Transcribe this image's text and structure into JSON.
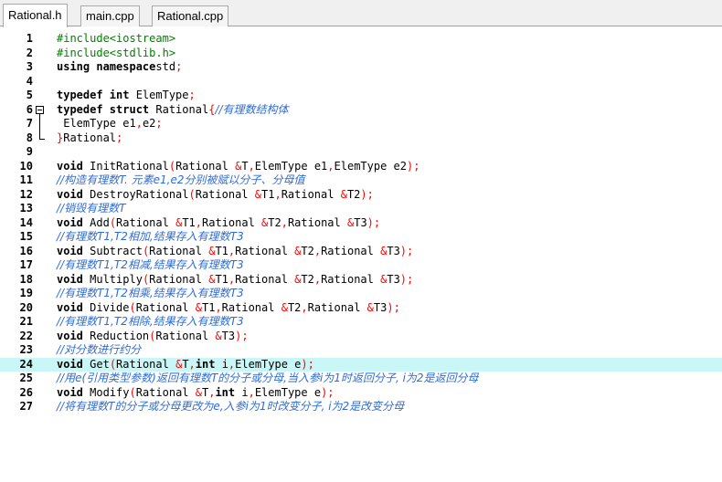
{
  "tabs": [
    {
      "label": "Rational.h",
      "active": true
    },
    {
      "label": "main.cpp",
      "active": false
    },
    {
      "label": "Rational.cpp",
      "active": false
    }
  ],
  "editor": {
    "highlight_line": 24,
    "lines": [
      {
        "n": "1",
        "t": [
          [
            "pp",
            "#include<iostream>"
          ]
        ]
      },
      {
        "n": "2",
        "t": [
          [
            "pp",
            "#include<stdlib.h>"
          ]
        ]
      },
      {
        "n": "3",
        "t": [
          [
            "kw",
            "using namespace"
          ],
          [
            "",
            "std"
          ],
          [
            "sym",
            ";"
          ]
        ]
      },
      {
        "n": "4",
        "t": []
      },
      {
        "n": "5",
        "t": [
          [
            "kw",
            "typedef int"
          ],
          [
            "",
            " ElemType"
          ],
          [
            "sym",
            ";"
          ]
        ]
      },
      {
        "n": "6",
        "t": [
          [
            "kw",
            "typedef struct"
          ],
          [
            "",
            " Rational"
          ],
          [
            "sym",
            "{"
          ],
          [
            "cm",
            "//有理数结构体"
          ]
        ]
      },
      {
        "n": "7",
        "t": [
          [
            "",
            " ElemType e1"
          ],
          [
            "sym",
            ","
          ],
          [
            "",
            "e2"
          ],
          [
            "sym",
            ";"
          ]
        ]
      },
      {
        "n": "8",
        "t": [
          [
            "sym",
            "}"
          ],
          [
            "",
            "Rational"
          ],
          [
            "sym",
            ";"
          ]
        ]
      },
      {
        "n": "9",
        "t": []
      },
      {
        "n": "10",
        "t": [
          [
            "kw",
            "void"
          ],
          [
            "",
            " InitRational"
          ],
          [
            "sym",
            "("
          ],
          [
            "",
            "Rational "
          ],
          [
            "sym",
            "&"
          ],
          [
            "",
            "T"
          ],
          [
            "sym",
            ","
          ],
          [
            "",
            "ElemType e1"
          ],
          [
            "sym",
            ","
          ],
          [
            "",
            "ElemType e2"
          ],
          [
            "sym",
            ");"
          ]
        ]
      },
      {
        "n": "11",
        "t": [
          [
            "cm",
            "//构造有理数T. 元素e1,e2分别被赋以分子、分母值"
          ]
        ]
      },
      {
        "n": "12",
        "t": [
          [
            "kw",
            "void"
          ],
          [
            "",
            " DestroyRational"
          ],
          [
            "sym",
            "("
          ],
          [
            "",
            "Rational "
          ],
          [
            "sym",
            "&"
          ],
          [
            "",
            "T1"
          ],
          [
            "sym",
            ","
          ],
          [
            "",
            "Rational "
          ],
          [
            "sym",
            "&"
          ],
          [
            "",
            "T2"
          ],
          [
            "sym",
            ");"
          ]
        ]
      },
      {
        "n": "13",
        "t": [
          [
            "cm",
            "//销毁有理数T"
          ]
        ]
      },
      {
        "n": "14",
        "t": [
          [
            "kw",
            "void"
          ],
          [
            "",
            " Add"
          ],
          [
            "sym",
            "("
          ],
          [
            "",
            "Rational "
          ],
          [
            "sym",
            "&"
          ],
          [
            "",
            "T1"
          ],
          [
            "sym",
            ","
          ],
          [
            "",
            "Rational "
          ],
          [
            "sym",
            "&"
          ],
          [
            "",
            "T2"
          ],
          [
            "sym",
            ","
          ],
          [
            "",
            "Rational "
          ],
          [
            "sym",
            "&"
          ],
          [
            "",
            "T3"
          ],
          [
            "sym",
            ");"
          ]
        ]
      },
      {
        "n": "15",
        "t": [
          [
            "cm",
            "//有理数T1,T2相加,结果存入有理数T3"
          ]
        ]
      },
      {
        "n": "16",
        "t": [
          [
            "kw",
            "void"
          ],
          [
            "",
            " Subtract"
          ],
          [
            "sym",
            "("
          ],
          [
            "",
            "Rational "
          ],
          [
            "sym",
            "&"
          ],
          [
            "",
            "T1"
          ],
          [
            "sym",
            ","
          ],
          [
            "",
            "Rational "
          ],
          [
            "sym",
            "&"
          ],
          [
            "",
            "T2"
          ],
          [
            "sym",
            ","
          ],
          [
            "",
            "Rational "
          ],
          [
            "sym",
            "&"
          ],
          [
            "",
            "T3"
          ],
          [
            "sym",
            ");"
          ]
        ]
      },
      {
        "n": "17",
        "t": [
          [
            "cm",
            "//有理数T1,T2相减,结果存入有理数T3"
          ]
        ]
      },
      {
        "n": "18",
        "t": [
          [
            "kw",
            "void"
          ],
          [
            "",
            " Multiply"
          ],
          [
            "sym",
            "("
          ],
          [
            "",
            "Rational "
          ],
          [
            "sym",
            "&"
          ],
          [
            "",
            "T1"
          ],
          [
            "sym",
            ","
          ],
          [
            "",
            "Rational "
          ],
          [
            "sym",
            "&"
          ],
          [
            "",
            "T2"
          ],
          [
            "sym",
            ","
          ],
          [
            "",
            "Rational "
          ],
          [
            "sym",
            "&"
          ],
          [
            "",
            "T3"
          ],
          [
            "sym",
            ");"
          ]
        ]
      },
      {
        "n": "19",
        "t": [
          [
            "cm",
            "//有理数T1,T2相乘,结果存入有理数T3"
          ]
        ]
      },
      {
        "n": "20",
        "t": [
          [
            "kw",
            "void"
          ],
          [
            "",
            " Divide"
          ],
          [
            "sym",
            "("
          ],
          [
            "",
            "Rational "
          ],
          [
            "sym",
            "&"
          ],
          [
            "",
            "T1"
          ],
          [
            "sym",
            ","
          ],
          [
            "",
            "Rational "
          ],
          [
            "sym",
            "&"
          ],
          [
            "",
            "T2"
          ],
          [
            "sym",
            ","
          ],
          [
            "",
            "Rational "
          ],
          [
            "sym",
            "&"
          ],
          [
            "",
            "T3"
          ],
          [
            "sym",
            ");"
          ]
        ]
      },
      {
        "n": "21",
        "t": [
          [
            "cm",
            "//有理数T1,T2相除,结果存入有理数T3"
          ]
        ]
      },
      {
        "n": "22",
        "t": [
          [
            "kw",
            "void"
          ],
          [
            "",
            " Reduction"
          ],
          [
            "sym",
            "("
          ],
          [
            "",
            "Rational "
          ],
          [
            "sym",
            "&"
          ],
          [
            "",
            "T3"
          ],
          [
            "sym",
            ");"
          ]
        ]
      },
      {
        "n": "23",
        "t": [
          [
            "cm",
            "//对分数进行约分"
          ]
        ]
      },
      {
        "n": "24",
        "t": [
          [
            "kw",
            "void"
          ],
          [
            "",
            " Get"
          ],
          [
            "sym",
            "("
          ],
          [
            "",
            "Rational "
          ],
          [
            "sym",
            "&"
          ],
          [
            "",
            "T"
          ],
          [
            "sym",
            ","
          ],
          [
            "kw",
            "int"
          ],
          [
            "",
            " i"
          ],
          [
            "sym",
            ","
          ],
          [
            "",
            "ElemType e"
          ],
          [
            "sym",
            ");"
          ]
        ]
      },
      {
        "n": "25",
        "t": [
          [
            "cm",
            "//用e(引用类型参数)返回有理数T的分子或分母,当入参i为1时返回分子, i为2是返回分母"
          ]
        ]
      },
      {
        "n": "26",
        "t": [
          [
            "kw",
            "void"
          ],
          [
            "",
            " Modify"
          ],
          [
            "sym",
            "("
          ],
          [
            "",
            "Rational "
          ],
          [
            "sym",
            "&"
          ],
          [
            "",
            "T"
          ],
          [
            "sym",
            ","
          ],
          [
            "kw",
            "int"
          ],
          [
            "",
            " i"
          ],
          [
            "sym",
            ","
          ],
          [
            "",
            "ElemType e"
          ],
          [
            "sym",
            ");"
          ]
        ]
      },
      {
        "n": "27",
        "t": [
          [
            "cm",
            "//将有理数T的分子或分母更改为e,入参i为1时改变分子, i为2是改变分母"
          ]
        ]
      }
    ]
  }
}
